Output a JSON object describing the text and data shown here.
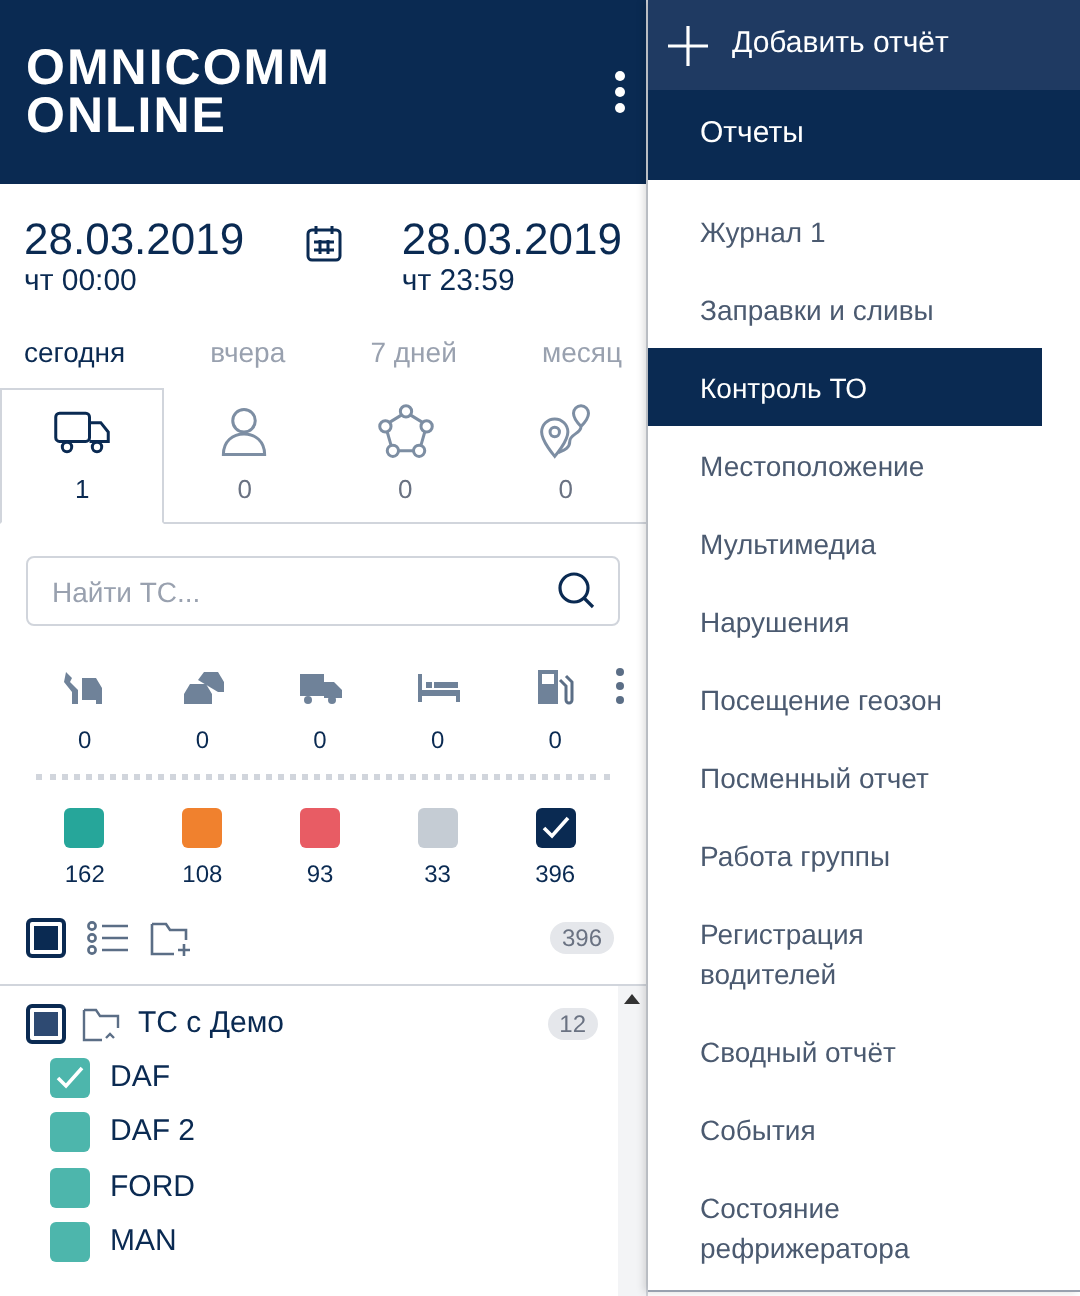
{
  "header": {
    "logo": [
      "OMNICOMM",
      "ONLINE"
    ]
  },
  "period": {
    "start": {
      "date": "28.03.2019",
      "time": "чт 00:00"
    },
    "end": {
      "date": "28.03.2019",
      "time": "чт 23:59"
    }
  },
  "ranges": [
    {
      "label": "сегодня",
      "selected": true
    },
    {
      "label": "вчера",
      "selected": false
    },
    {
      "label": "7 дней",
      "selected": false
    },
    {
      "label": "месяц",
      "selected": false
    }
  ],
  "object_tabs": [
    {
      "kind": "vehicle",
      "count": "1",
      "selected": true
    },
    {
      "kind": "driver",
      "count": "0",
      "selected": false
    },
    {
      "kind": "geozone",
      "count": "0",
      "selected": false
    },
    {
      "kind": "route",
      "count": "0",
      "selected": false
    }
  ],
  "search": {
    "placeholder": "Найти ТС..."
  },
  "status_filters": [
    {
      "kind": "repair",
      "count": "0"
    },
    {
      "kind": "traffic",
      "count": "0"
    },
    {
      "kind": "truck",
      "count": "0"
    },
    {
      "kind": "rest",
      "count": "0"
    },
    {
      "kind": "fuel",
      "count": "0"
    }
  ],
  "color_filters": [
    {
      "color": "#26a69a",
      "count": "162",
      "checked": false
    },
    {
      "color": "#f0812e",
      "count": "108",
      "checked": false
    },
    {
      "color": "#e85c64",
      "count": "93",
      "checked": false
    },
    {
      "color": "#c5ccd4",
      "count": "33",
      "checked": false
    },
    {
      "color": "#0a2a52",
      "count": "396",
      "checked": true
    }
  ],
  "toolbar": {
    "checked": true,
    "total": "396"
  },
  "groups": [
    {
      "label": "ТС с Демо",
      "count": "12",
      "checked": true,
      "vehicles": [
        {
          "label": "DAF",
          "color": "#4db6ac",
          "checked": true
        },
        {
          "label": "DAF 2",
          "color": "#4db6ac",
          "checked": false
        },
        {
          "label": "FORD",
          "color": "#4db6ac",
          "checked": false
        },
        {
          "label": "MAN",
          "color": "#4db6ac",
          "checked": false
        }
      ]
    }
  ],
  "reports_menu": {
    "add_button": "Добавить отчёт",
    "title": "Отчеты",
    "items": [
      {
        "label": "Журнал 1",
        "selected": false
      },
      {
        "label": "Заправки и сливы",
        "selected": false
      },
      {
        "label": "Контроль ТО",
        "selected": true
      },
      {
        "label": "Местоположение",
        "selected": false
      },
      {
        "label": "Мультимедиа",
        "selected": false
      },
      {
        "label": "Нарушения",
        "selected": false
      },
      {
        "label": "Посещение геозон",
        "selected": false
      },
      {
        "label": "Посменный отчет",
        "selected": false
      },
      {
        "label": "Работа группы",
        "selected": false
      },
      {
        "label": "Регистрация водителей",
        "selected": false
      },
      {
        "label": "Сводный отчёт",
        "selected": false
      },
      {
        "label": "События",
        "selected": false
      },
      {
        "label": "Состояние рефрижератора",
        "selected": false
      }
    ]
  }
}
